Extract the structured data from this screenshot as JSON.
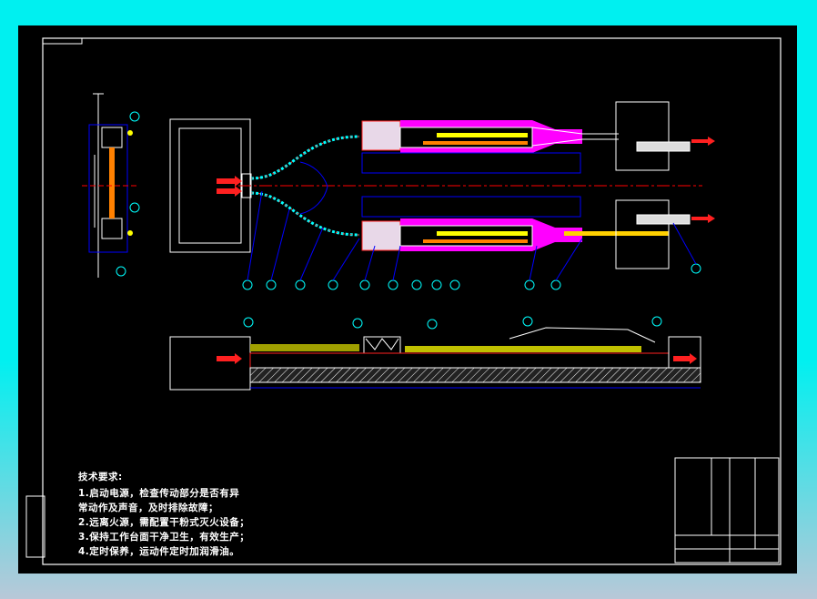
{
  "drawing": {
    "technical_requirements": {
      "title": "技术要求:",
      "items": [
        "1.启动电源，检查传动部分是否有异",
        "常动作及声音，及时排除故障；",
        "2.远离火源，需配置干粉式灭火设备；",
        "3.保持工作台面干净卫生，有效生产；",
        "4.定时保养，运动件定时加润滑油。"
      ]
    },
    "colors": {
      "background": "#000000",
      "frame": "#ffffff",
      "dimension": "#0000ff",
      "heating": "#ff00ff",
      "flow_arrow": "#ff2020",
      "centerline": "#ff0000",
      "label": "#00ff00"
    }
  }
}
